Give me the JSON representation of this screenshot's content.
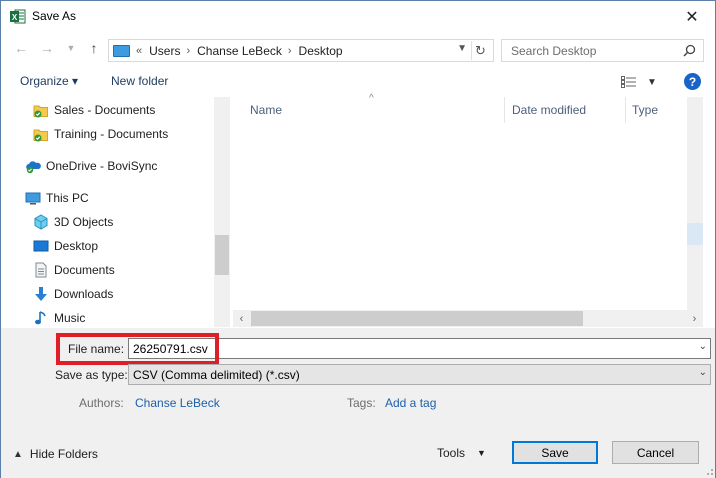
{
  "window": {
    "title": "Save As",
    "close_glyph": "✕"
  },
  "nav": {
    "back_icon": "arrow-left-icon",
    "forward_icon": "arrow-right-icon",
    "recent_icon": "chevron-down-icon",
    "up_icon": "arrow-up-icon",
    "breadcrumbs": [
      "«",
      "Users",
      "›",
      "Chanse LeBeck",
      "›",
      "Desktop"
    ],
    "search_placeholder": "Search Desktop"
  },
  "toolbar": {
    "organize": "Organize ▾",
    "new_folder": "New folder"
  },
  "tree": {
    "items": [
      {
        "label": "Sales - Documents",
        "icon": "sharepoint-folder-icon"
      },
      {
        "label": "Training - Documents",
        "icon": "sharepoint-folder-icon"
      },
      {
        "label": "OneDrive - BoviSync",
        "icon": "onedrive-icon"
      },
      {
        "label": "This PC",
        "icon": "computer-icon"
      },
      {
        "label": "3D Objects",
        "icon": "3d-objects-icon"
      },
      {
        "label": "Desktop",
        "icon": "desktop-icon"
      },
      {
        "label": "Documents",
        "icon": "document-icon"
      },
      {
        "label": "Downloads",
        "icon": "download-icon"
      },
      {
        "label": "Music",
        "icon": "music-icon"
      }
    ]
  },
  "files": {
    "columns": [
      "Name",
      "Date modified",
      "Type"
    ]
  },
  "form": {
    "file_name_label": "File name:",
    "file_name_value": "26250791.csv",
    "save_type_label": "Save as type:",
    "save_type_value": "CSV (Comma delimited) (*.csv)",
    "authors_label": "Authors:",
    "authors_value": "Chanse LeBeck",
    "tags_label": "Tags:",
    "tags_value": "Add a tag"
  },
  "footer": {
    "hide_folders": "Hide Folders",
    "tools": "Tools",
    "save": "Save",
    "cancel": "Cancel"
  },
  "colors": {
    "accent": "#0078d7",
    "highlight_box": "#e01e27",
    "link": "#1e5fa8"
  }
}
